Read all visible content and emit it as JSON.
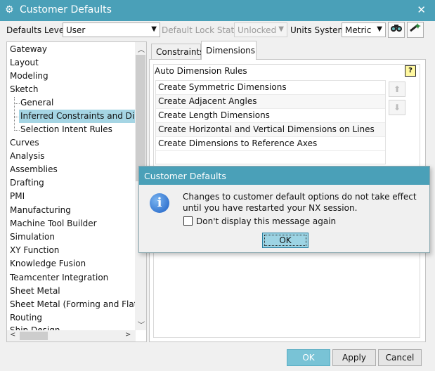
{
  "window": {
    "title": "Customer Defaults",
    "close_glyph": "✕",
    "gear_glyph": "⚙"
  },
  "toolbar": {
    "defaults_level_label": "Defaults Level",
    "defaults_level_value": "User",
    "lock_state_label": "Default Lock State",
    "lock_state_value": "Unlocked",
    "units_label": "Units System",
    "units_value": "Metric",
    "icon1": "binoculars-icon",
    "icon2": "wand-icon"
  },
  "tree": {
    "items": [
      "Gateway",
      "Layout",
      "Modeling",
      "Sketch",
      "General",
      "Inferred Constraints and Dime",
      "Selection Intent Rules",
      "Curves",
      "Analysis",
      "Assemblies",
      "Drafting",
      "PMI",
      "Manufacturing",
      "Machine Tool Builder",
      "Simulation",
      "XY Function",
      "Knowledge Fusion",
      "Teamcenter Integration",
      "Sheet Metal",
      "Sheet Metal (Forming and Flatte",
      "Routing",
      "Ship Design"
    ]
  },
  "tabs": [
    "Constraints",
    "Dimensions"
  ],
  "rules": {
    "title": "Auto Dimension Rules",
    "help": "?",
    "items": [
      "Create Symmetric Dimensions",
      "Create Adjacent Angles",
      "Create Length Dimensions",
      "Create Horizontal and Vertical Dimensions on Lines",
      "Create Dimensions to Reference Axes"
    ]
  },
  "buttons": {
    "ok": "OK",
    "apply": "Apply",
    "cancel": "Cancel"
  },
  "dialog": {
    "title": "Customer Defaults",
    "message": "Changes to customer default options do not take effect until you have restarted your NX session.",
    "checkbox_label": "Don't display this message again",
    "ok": "OK"
  }
}
